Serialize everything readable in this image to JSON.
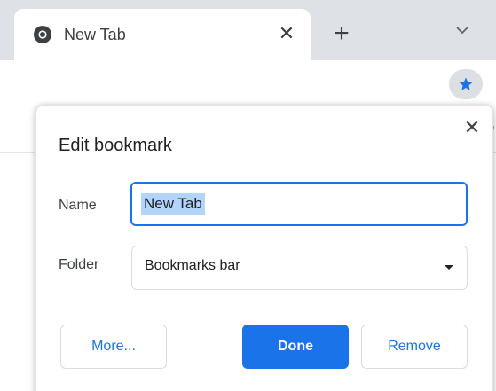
{
  "tab": {
    "title": "New Tab",
    "close_glyph": "✕",
    "favicon": "chrome-icon"
  },
  "tabstrip": {
    "new_tab_glyph": "+",
    "tab_search_icon": "chevron-down-icon"
  },
  "toolbar": {
    "bookmark_icon": "star-icon",
    "bookmark_active_color": "#1a73e8"
  },
  "dialog": {
    "title": "Edit bookmark",
    "close_glyph": "✕",
    "name_label": "Name",
    "name_value": "New Tab",
    "folder_label": "Folder",
    "folder_value": "Bookmarks bar",
    "more_label": "More...",
    "done_label": "Done",
    "remove_label": "Remove"
  },
  "colors": {
    "accent": "#1a73e8",
    "tabstrip_bg": "#dee1e6",
    "selection": "#b3d4fc"
  }
}
